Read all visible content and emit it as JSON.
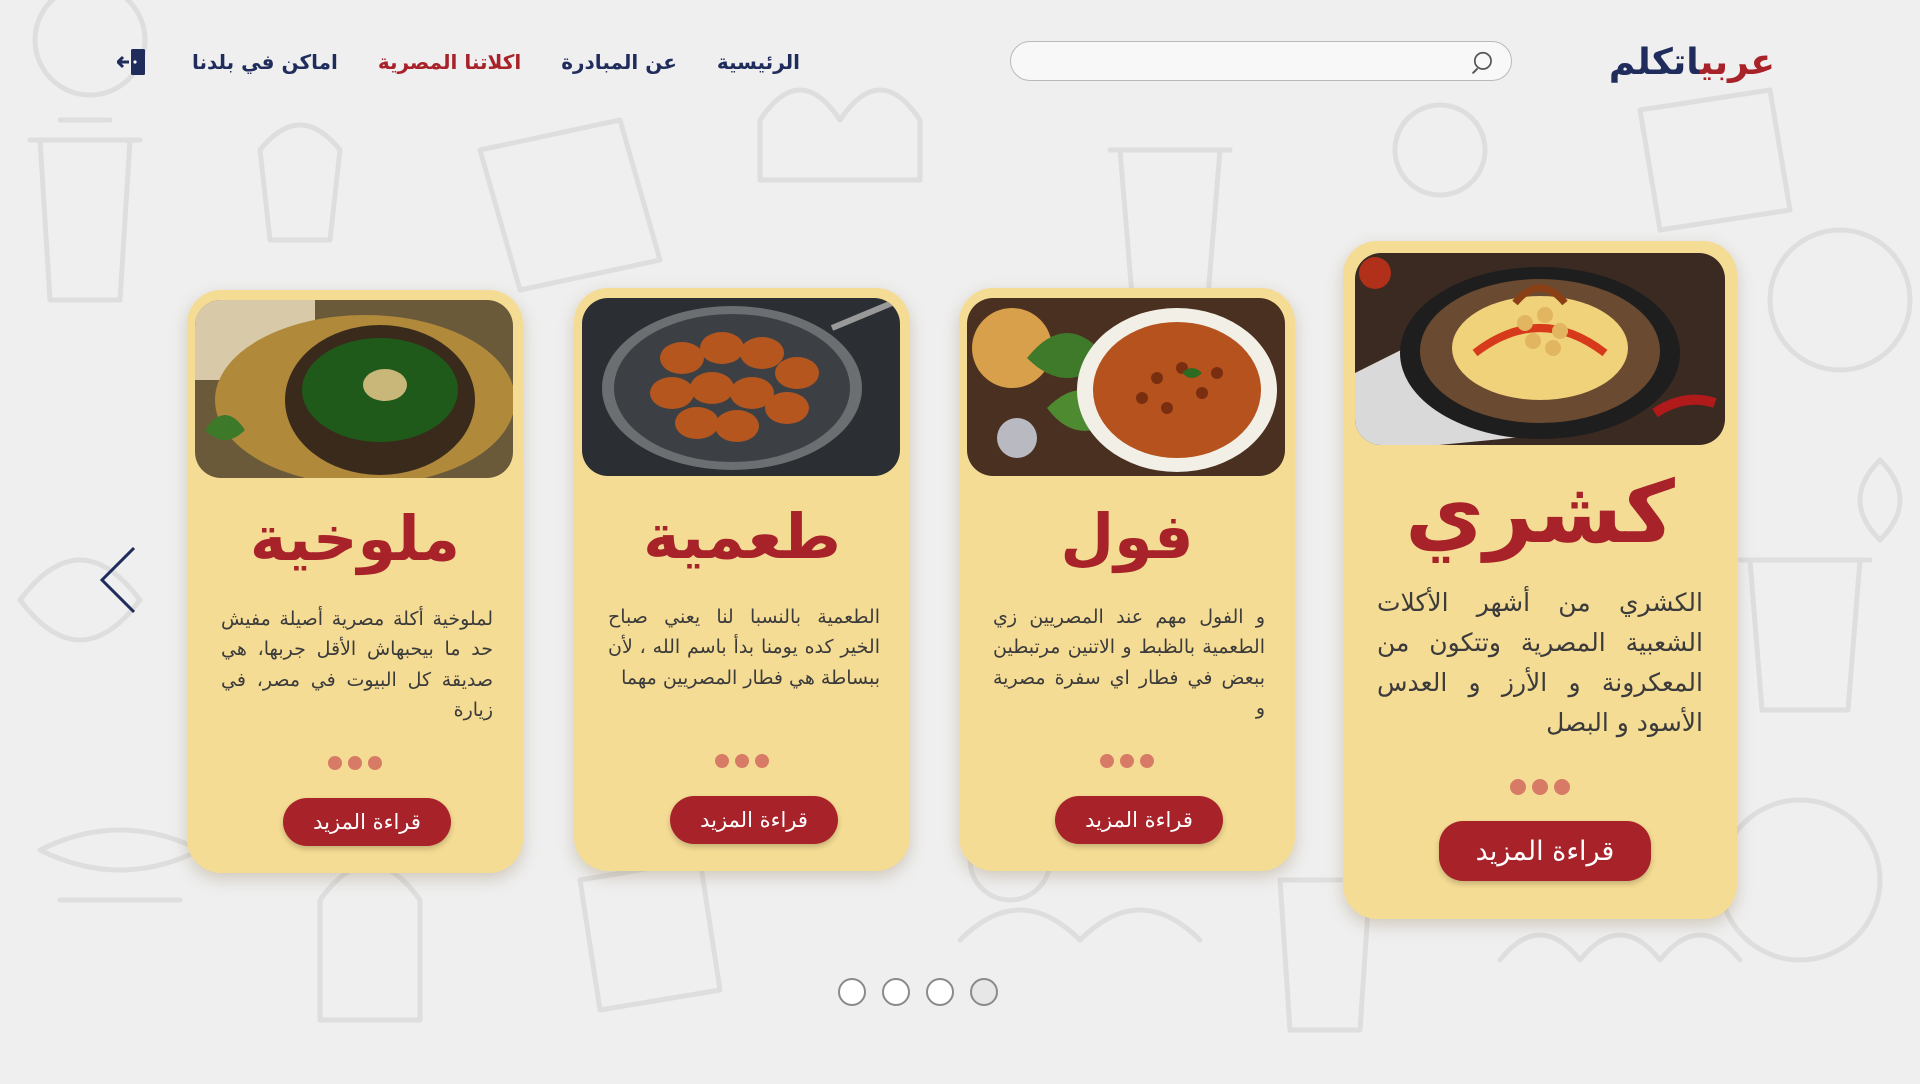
{
  "header": {
    "logo_main": "اتكلم",
    "logo_accent": "عربي",
    "search_placeholder": "",
    "nav": [
      {
        "label": "الرئيسية",
        "active": false
      },
      {
        "label": "عن المبادرة",
        "active": false
      },
      {
        "label": "اكلاتنا المصرية",
        "active": true
      },
      {
        "label": "اماكن في بلدنا",
        "active": false
      }
    ]
  },
  "cards": [
    {
      "id": "koshary",
      "title": "كشري",
      "description": "الكشري من أشهر الأكلات الشعبية المصرية وتتكون من المعكرونة و الأرز و العدس الأسود و البصل",
      "button_label": "قراءة المزيد",
      "image": "koshary-photo",
      "featured": true
    },
    {
      "id": "foul",
      "title": "فول",
      "description": "و الفول مهم عند المصريين زي الطعمية بالظبط و الاتنين مرتبطين ببعض في فطار اي سفرة مصرية و",
      "button_label": "قراءة المزيد",
      "image": "foul-photo",
      "featured": false
    },
    {
      "id": "taameya",
      "title": "طعمية",
      "description": "الطعمية بالنسبا لنا يعني صباح الخير كده يومنا بدأ باسم الله ، لأن ببساطة هي فطار المصريين مهما",
      "button_label": "قراءة المزيد",
      "image": "taameya-photo",
      "featured": false
    },
    {
      "id": "molokhia",
      "title": "ملوخية",
      "description": "لملوخية أكلة مصرية أصيلة مفيش حد ما بيحبهاش الأقل جربها، هي صديقة كل البيوت في مصر، في زيارة",
      "button_label": "قراءة المزيد",
      "image": "molokhia-photo",
      "featured": false
    }
  ],
  "pager": {
    "count": 4,
    "active_index": 3
  },
  "colors": {
    "brand_red": "#a8222a",
    "brand_navy": "#1f2c5c",
    "card_bg": "#f5dc94",
    "dots": "#d87b66"
  }
}
